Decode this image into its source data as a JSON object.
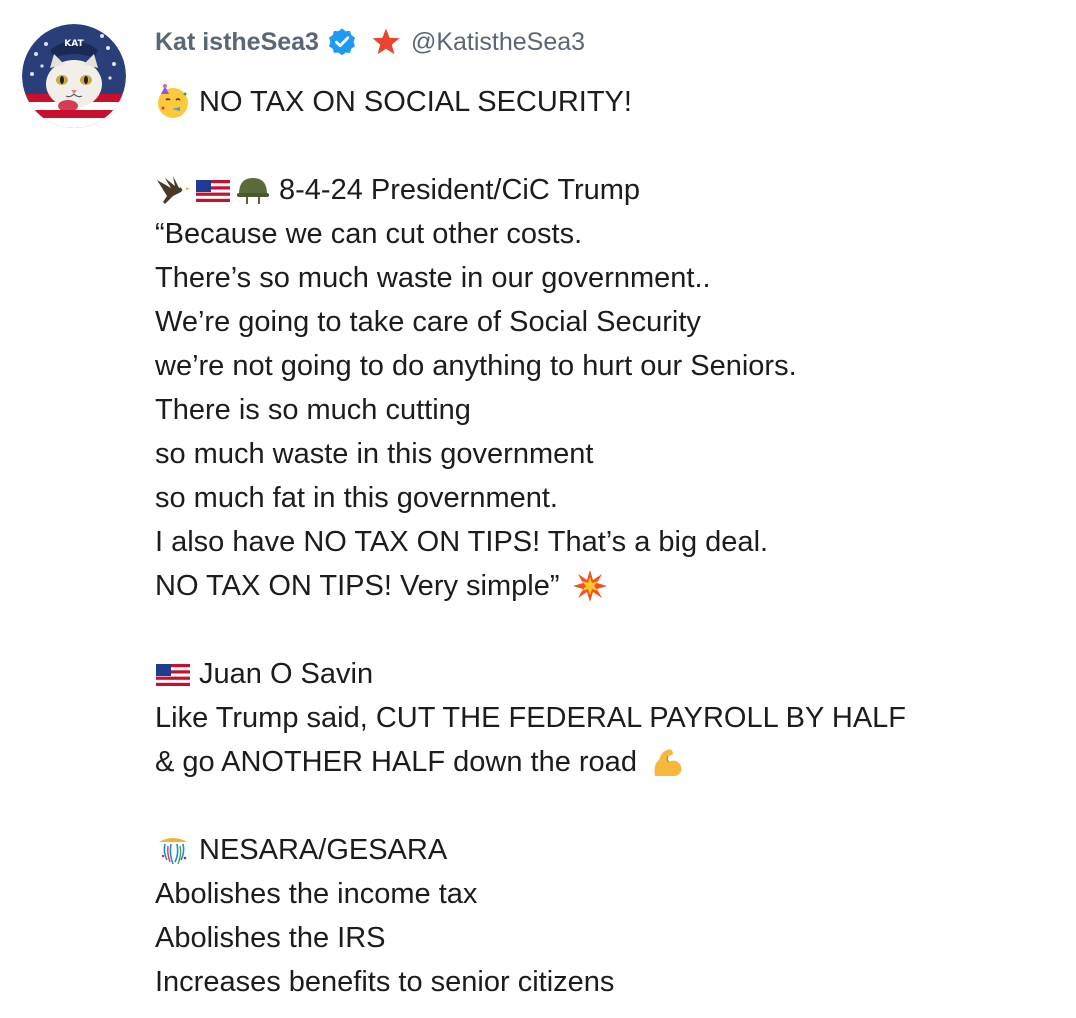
{
  "post": {
    "author": {
      "display_name": "Kat istheSea3",
      "handle": "@KatistheSea3",
      "avatar_text": "KAT",
      "verified_icon": "verified-check-icon",
      "badge_icon": "red-star-icon"
    },
    "colors": {
      "name_gray": "#5a6676",
      "verified_blue": "#1d9bf0",
      "star_red": "#e8442e",
      "text": "#1c1c1e"
    },
    "lines": [
      "NO TAX ON SOCIAL SECURITY!",
      "",
      "8-4-24 President/CiC Trump",
      "“Because we can cut other costs.",
      "There’s so much waste in our government..",
      "We’re going to take care of Social Security",
      "we’re not going to do anything to hurt our Seniors.",
      "There is so much cutting",
      "so much waste in this government",
      "so much fat in this government.",
      "I also have NO TAX ON TIPS! That’s a big deal.",
      "NO TAX ON TIPS! Very simple”",
      "",
      "Juan O Savin",
      "Like Trump said, CUT THE FEDERAL PAYROLL BY HALF",
      "& go ANOTHER HALF down the road",
      "",
      "NESARA/GESARA",
      "Abolishes the income tax",
      "Abolishes the IRS",
      "Increases benefits to senior citizens"
    ],
    "emojis": {
      "party_face": "partying-face-emoji",
      "eagle": "eagle-emoji",
      "us_flag": "us-flag-emoji",
      "helmet": "military-helmet-emoji",
      "collision": "collision-emoji",
      "flexed_biceps": "flexed-biceps-emoji",
      "confetti_ball": "confetti-ball-emoji"
    }
  }
}
